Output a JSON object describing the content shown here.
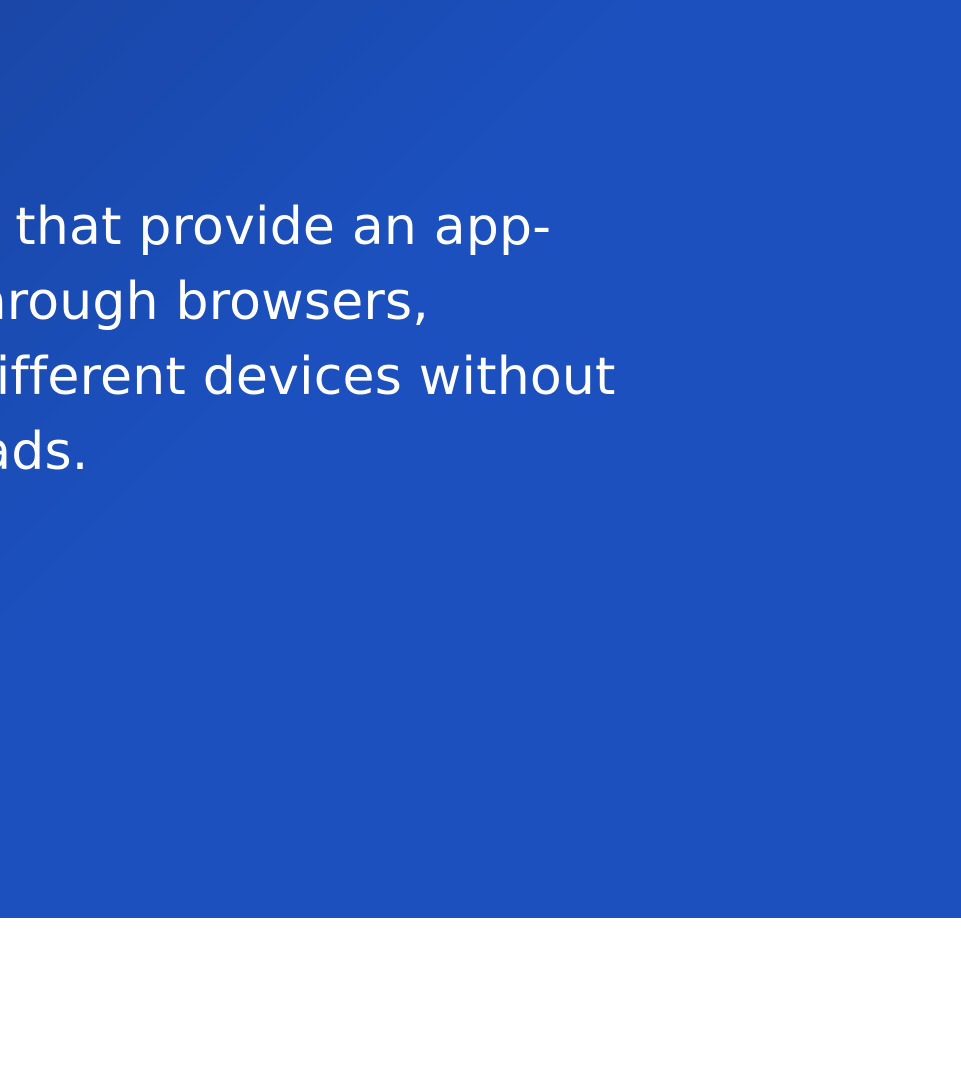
{
  "hero": {
    "lines": [
      "cations that provide an app-",
      "ence through browsers,",
      "cross different devices without",
      "lownloads."
    ]
  },
  "colors": {
    "hero_background": "#1b50be",
    "hero_text": "#ffffff",
    "page_background": "#ffffff"
  }
}
